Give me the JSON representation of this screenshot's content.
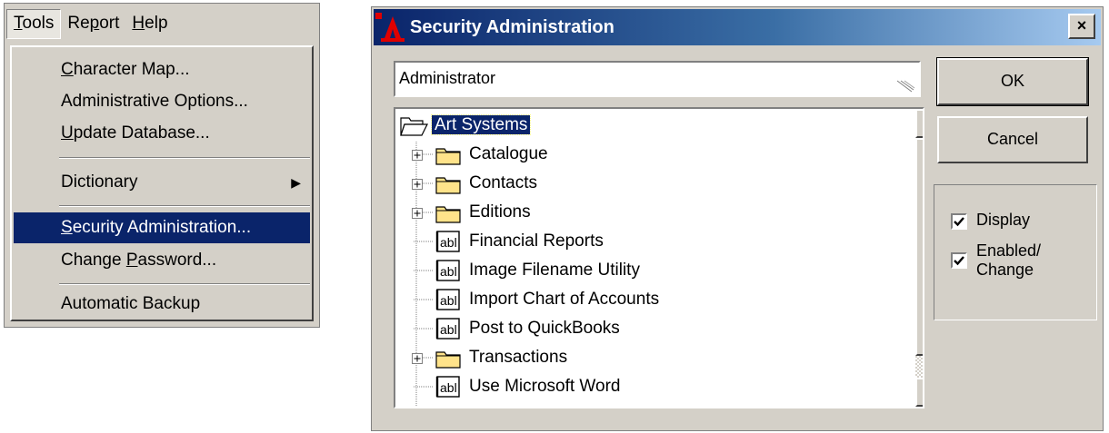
{
  "menubar": {
    "items": [
      {
        "label": "Tools",
        "mnemonic_index": 0
      },
      {
        "label": "Report",
        "mnemonic_index": 2
      },
      {
        "label": "Help",
        "mnemonic_index": 0
      }
    ]
  },
  "tools_menu": {
    "items": [
      {
        "label": "Character Map...",
        "mnemonic_index": 0
      },
      {
        "label": "Administrative Options...",
        "mnemonic_index": -1
      },
      {
        "label": "Update Database...",
        "mnemonic_index": 0
      },
      {
        "label": "Dictionary",
        "mnemonic_index": -1,
        "submenu": true
      },
      {
        "label": "Security Administration...",
        "mnemonic_index": 0,
        "selected": true
      },
      {
        "label": "Change Password...",
        "mnemonic_index": 7
      },
      {
        "label": "Automatic Backup",
        "mnemonic_index": -1
      }
    ]
  },
  "dialog": {
    "title": "Security Administration",
    "close_label": "×",
    "user_field": {
      "value": "Administrator"
    },
    "ok_label": "OK",
    "cancel_label": "Cancel",
    "tree": [
      {
        "label": "Art Systems",
        "icon": "open-folder-icon",
        "level": 0,
        "selected": true
      },
      {
        "label": "Catalogue",
        "icon": "folder-icon",
        "level": 1,
        "expandable": true
      },
      {
        "label": "Contacts",
        "icon": "folder-icon",
        "level": 1,
        "expandable": true
      },
      {
        "label": "Editions",
        "icon": "folder-icon",
        "level": 1,
        "expandable": true
      },
      {
        "label": "Financial Reports",
        "icon": "form-abl-icon",
        "level": 1
      },
      {
        "label": "Image Filename Utility",
        "icon": "form-abl-icon",
        "level": 1
      },
      {
        "label": "Import Chart of Accounts",
        "icon": "form-abl-icon",
        "level": 1
      },
      {
        "label": "Post to QuickBooks",
        "icon": "form-abl-icon",
        "level": 1
      },
      {
        "label": "Transactions",
        "icon": "folder-icon",
        "level": 1,
        "expandable": true
      },
      {
        "label": "Use Microsoft Word",
        "icon": "form-abl-icon",
        "level": 1
      }
    ],
    "permissions": [
      {
        "label_lines": [
          "Display"
        ],
        "checked": true
      },
      {
        "label_lines": [
          "Enabled/",
          "Change"
        ],
        "checked": true
      }
    ]
  },
  "colors": {
    "face": "#d4d0c8",
    "selection": "#0a246a",
    "title_start": "#0a246a",
    "title_end": "#a6caf0",
    "folder": "#ffe38a"
  }
}
